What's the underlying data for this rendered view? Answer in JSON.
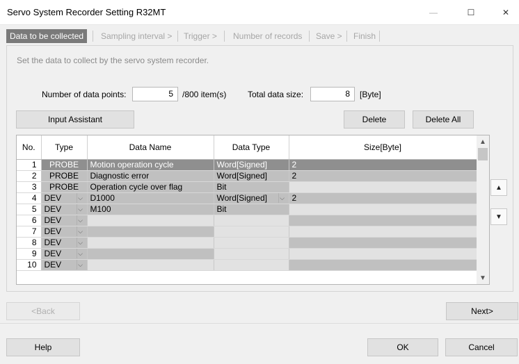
{
  "window": {
    "title": "Servo System Recorder Setting R32MT",
    "minimize": "—",
    "maximize": "☐",
    "close": "✕"
  },
  "steps": [
    {
      "label": "Data to be collected",
      "active": true
    },
    {
      "label": "Sampling interval >",
      "active": false
    },
    {
      "label": "Trigger >",
      "active": false
    },
    {
      "label": "Number of records",
      "active": false
    },
    {
      "label": "Save >",
      "active": false
    },
    {
      "label": "Finish",
      "active": false
    }
  ],
  "hint": "Set the data to collect by the servo system recorder.",
  "counts": {
    "points_label": "Number of data points:",
    "points_value": "5",
    "points_suffix": "/800 item(s)",
    "size_label": "Total data size:",
    "size_value": "8",
    "size_suffix": "[Byte]"
  },
  "buttons": {
    "input_assistant": "Input Assistant",
    "delete": "Delete",
    "delete_all": "Delete All",
    "back": "<Back",
    "next": "Next>",
    "help": "Help",
    "ok": "OK",
    "cancel": "Cancel"
  },
  "table": {
    "columns": [
      "No.",
      "Type",
      "Data Name",
      "Data Type",
      "Size[Byte]"
    ],
    "rows": [
      {
        "no": "1",
        "type": "PROBE",
        "name": "Motion operation cycle",
        "dtype": "Word[Signed]",
        "size": "2",
        "dropdown": false,
        "dtype_dropdown": false,
        "selected": true
      },
      {
        "no": "2",
        "type": "PROBE",
        "name": "Diagnostic error",
        "dtype": "Word[Signed]",
        "size": "2",
        "dropdown": false,
        "dtype_dropdown": false,
        "selected": false
      },
      {
        "no": "3",
        "type": "PROBE",
        "name": "Operation cycle over flag",
        "dtype": "Bit",
        "size": "",
        "dropdown": false,
        "dtype_dropdown": false,
        "selected": false
      },
      {
        "no": "4",
        "type": "DEV",
        "name": "D1000",
        "dtype": "Word[Signed]",
        "size": "2",
        "dropdown": true,
        "dtype_dropdown": true,
        "selected": false
      },
      {
        "no": "5",
        "type": "DEV",
        "name": "M100",
        "dtype": "Bit",
        "size": "",
        "dropdown": true,
        "dtype_dropdown": false,
        "selected": false
      },
      {
        "no": "6",
        "type": "DEV",
        "name": "",
        "dtype": "",
        "size": "",
        "dropdown": true,
        "dtype_dropdown": false,
        "selected": false
      },
      {
        "no": "7",
        "type": "DEV",
        "name": "",
        "dtype": "",
        "size": "",
        "dropdown": true,
        "dtype_dropdown": false,
        "selected": false
      },
      {
        "no": "8",
        "type": "DEV",
        "name": "",
        "dtype": "",
        "size": "",
        "dropdown": true,
        "dtype_dropdown": false,
        "selected": false
      },
      {
        "no": "9",
        "type": "DEV",
        "name": "",
        "dtype": "",
        "size": "",
        "dropdown": true,
        "dtype_dropdown": false,
        "selected": false
      },
      {
        "no": "10",
        "type": "DEV",
        "name": "",
        "dtype": "",
        "size": "",
        "dropdown": true,
        "dtype_dropdown": false,
        "selected": false
      }
    ]
  },
  "colors": {
    "active_step": "#7a7a7a",
    "selected_row": "#8f8f8f",
    "filled_cell": "#c0c0c0",
    "empty_cell": "#e2e2e2"
  },
  "icons": {
    "scroll_up": "chevron-up-icon",
    "scroll_down": "chevron-down-icon",
    "move_up": "triangle-up-icon",
    "move_down": "triangle-down-icon",
    "dropdown": "chevron-down-icon"
  }
}
